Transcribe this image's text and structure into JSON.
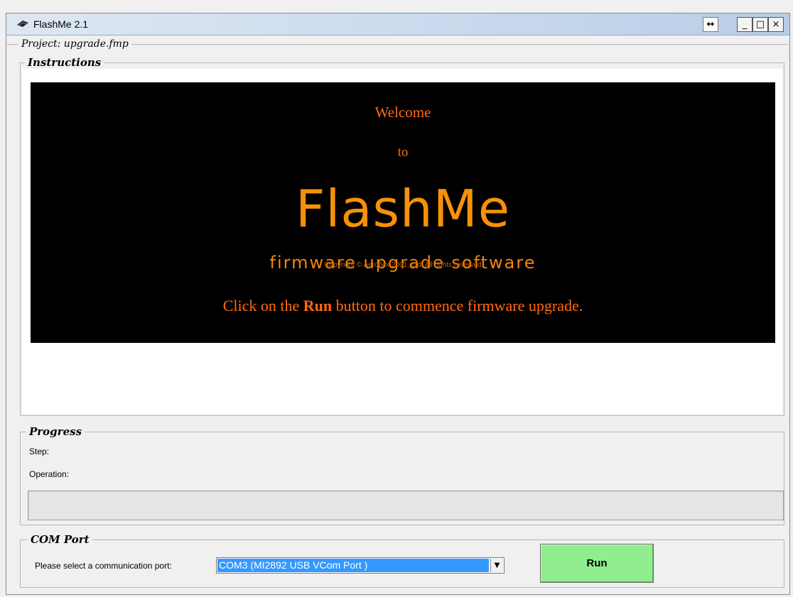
{
  "window": {
    "title": "FlashMe 2.1",
    "controls": {
      "resize": "↔",
      "minimize": "_",
      "maximize": "□",
      "close": "×"
    }
  },
  "project": {
    "label": "Project: upgrade.fmp"
  },
  "instructions": {
    "legend": "Instructions",
    "welcome": "Welcome",
    "to": "to",
    "brand": "FlashMe",
    "subtitle": "firmware upgrade software",
    "copyright_text": "Copyright © Aeroflex 2001, Ltd. All rights reserved",
    "cta_prefix": "Click on the ",
    "cta_bold": "Run",
    "cta_suffix": " button to commence firmware upgrade."
  },
  "progress": {
    "legend": "Progress",
    "step_label": "Step:",
    "operation_label": "Operation:",
    "percent": 0
  },
  "com_port": {
    "legend": "COM Port",
    "prompt": "Please select a communication port:",
    "selected": "COM3 (MI2892 USB VCom Port )"
  },
  "actions": {
    "run_label": "Run"
  },
  "colors": {
    "welcome_text": "#ff6a10",
    "brand_text": "#f59208",
    "run_button": "#90ee90",
    "selection": "#3399ff"
  }
}
